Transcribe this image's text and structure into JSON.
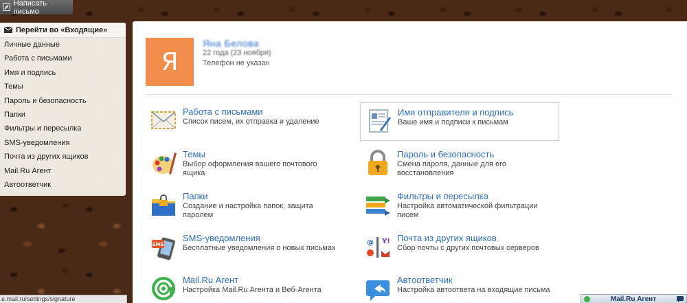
{
  "compose": {
    "label": "Написать письмо"
  },
  "sidebar": {
    "goto": "Перейти во «Входящие»",
    "items": [
      "Личные данные",
      "Работа с письмами",
      "Имя и подпись",
      "Темы",
      "Пароль и безопасность",
      "Папки",
      "Фильтры и пересылка",
      "SMS-уведомления",
      "Почта из других ящиков",
      "Mail.Ru Агент",
      "Автоответчик"
    ]
  },
  "profile": {
    "avatar_letter": "Я",
    "name": "Яна Белова",
    "age": "22 года (23 ноября)",
    "phone": "Телефон не указан"
  },
  "settings": [
    {
      "title": "Работа с письмами",
      "desc": "Список писем, их отправка и удаление",
      "icon": "envelope-icon"
    },
    {
      "title": "Имя отправителя и подпись",
      "desc": "Ваше имя и подписи к письмам",
      "icon": "signature-icon"
    },
    {
      "title": "Темы",
      "desc": "Выбор оформления вашего почтового ящика",
      "icon": "palette-icon"
    },
    {
      "title": "Пароль и безопасность",
      "desc": "Смена пароля, данные для его восстановления",
      "icon": "lock-icon"
    },
    {
      "title": "Папки",
      "desc": "Создание и настройка папок, защита паролем",
      "icon": "folder-lock-icon"
    },
    {
      "title": "Фильтры и пересылка",
      "desc": "Настройка автоматической фильтрации писем",
      "icon": "filter-icon"
    },
    {
      "title": "SMS-уведомления",
      "desc": "Бесплатные уведомления о новых письмах",
      "icon": "sms-phone-icon"
    },
    {
      "title": "Почта из других ящиков",
      "desc": "Сбор почты с других почтовых серверов",
      "icon": "collector-icon"
    },
    {
      "title": "Mail.Ru Агент",
      "desc": "Настройка Mail.Ru Агента и Веб-Агента",
      "icon": "at-sign-icon"
    },
    {
      "title": "Автоответчик",
      "desc": "Настройка автоответа на входящие письма",
      "icon": "autoreply-icon"
    }
  ],
  "status_url": "e.mail.ru/settings/signature",
  "agent": {
    "label": "Mail.Ru Агент"
  },
  "colors": {
    "link": "#2d6ec2",
    "avatar": "#f38d4b"
  }
}
